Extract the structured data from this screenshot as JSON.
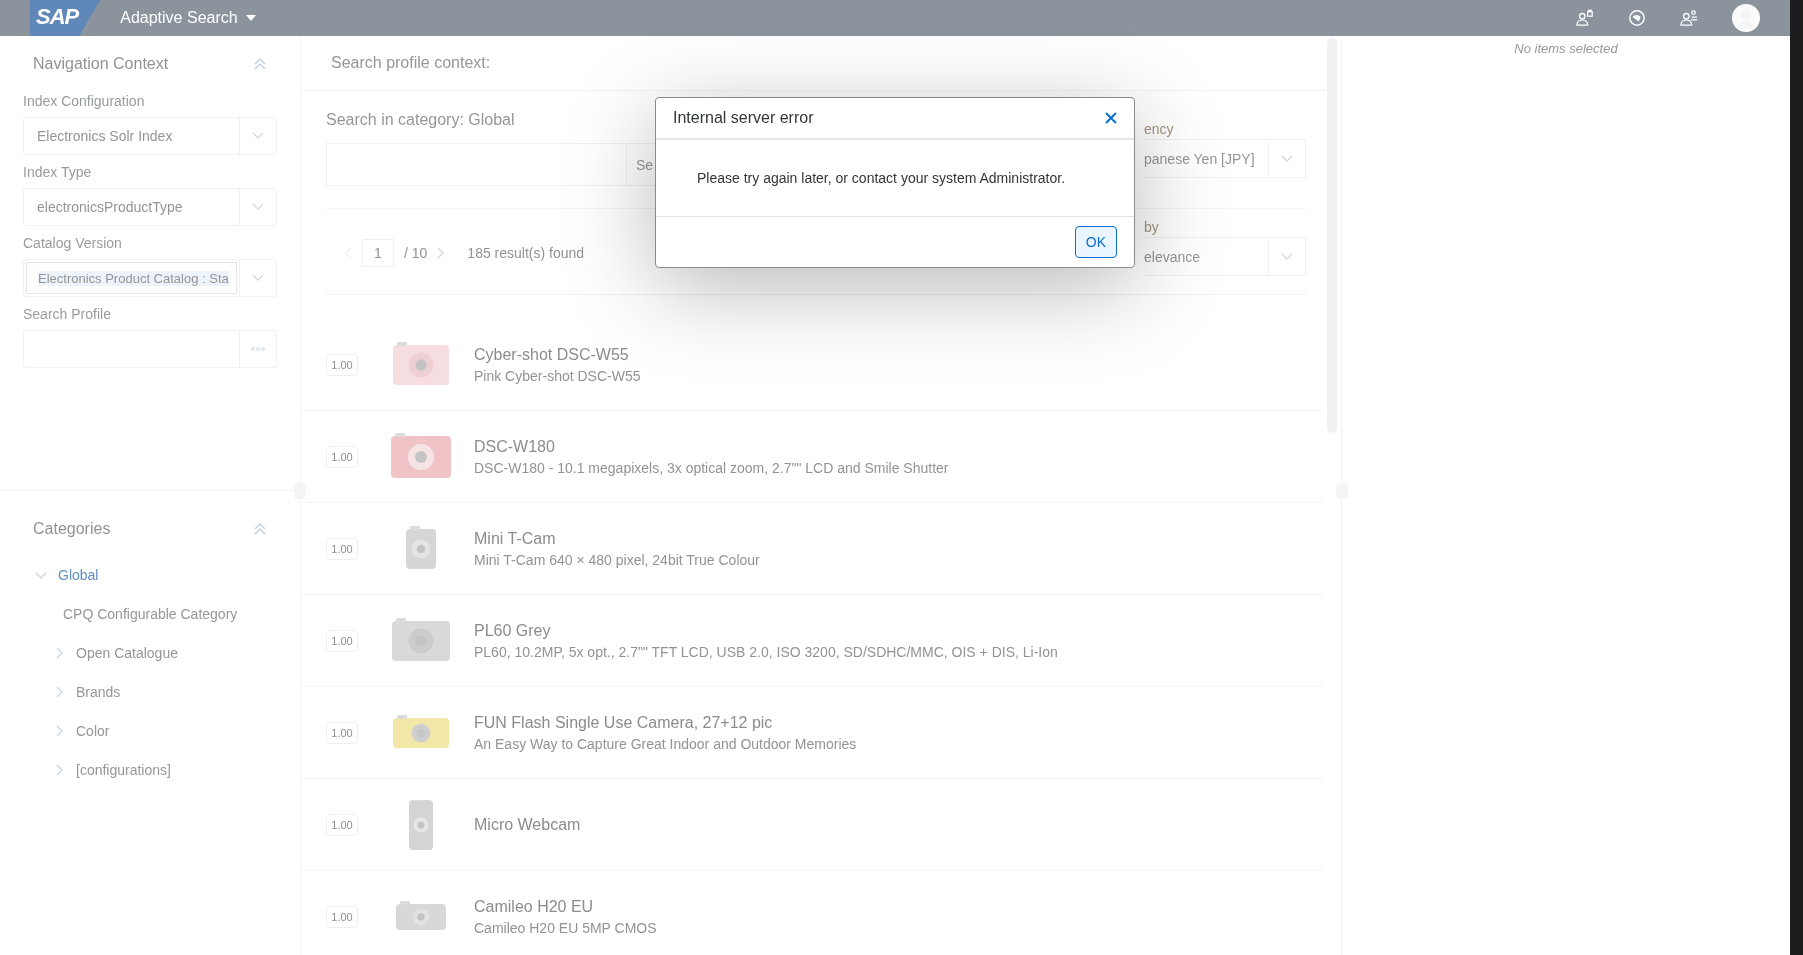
{
  "header": {
    "logo_text": "SAP",
    "app_title": "Adaptive Search"
  },
  "navigation_context": {
    "title": "Navigation Context",
    "fields": [
      {
        "label": "Index Configuration",
        "value": "Electronics Solr Index",
        "kind": "dropdown",
        "highlighted": false
      },
      {
        "label": "Index Type",
        "value": "electronicsProductType",
        "kind": "dropdown",
        "highlighted": false
      },
      {
        "label": "Catalog Version",
        "value": "Electronics Product Catalog : Sta",
        "kind": "dropdown",
        "highlighted": true
      },
      {
        "label": "Search Profile",
        "kind": "value_help",
        "highlighted": false
      }
    ]
  },
  "categories": {
    "title": "Categories",
    "tree": [
      {
        "label": "Global",
        "expandable": true,
        "expanded": true,
        "selected": true,
        "children": [
          {
            "label": "CPQ Configurable Category",
            "expandable": false,
            "expanded": false,
            "selected": false
          },
          {
            "label": "Open Catalogue",
            "expandable": true,
            "expanded": false,
            "selected": false
          },
          {
            "label": "Brands",
            "expandable": true,
            "expanded": false,
            "selected": false
          },
          {
            "label": "Color",
            "expandable": true,
            "expanded": false,
            "selected": false
          },
          {
            "label": "[configurations]",
            "expandable": true,
            "expanded": false,
            "selected": false
          }
        ]
      }
    ]
  },
  "search": {
    "context_title": "Search profile context:",
    "category_label": "Search in category: Global",
    "button": "Se",
    "currency_label": "ency",
    "currency_value": "panese Yen [JPY]",
    "sort_label": "by",
    "sort_value": "elevance"
  },
  "pagination": {
    "page": "1",
    "total": "/ 10",
    "prev_disabled": true,
    "next_disabled": false,
    "results": "185 result(s) found"
  },
  "products": [
    {
      "score": "1.00",
      "name": "Cyber-shot DSC-W55",
      "description": "Pink Cyber-shot DSC-W55"
    },
    {
      "score": "1.00",
      "name": "DSC-W180",
      "description": "DSC-W180 - 10.1 megapixels, 3x optical zoom, 2.7\"\" LCD and Smile Shutter"
    },
    {
      "score": "1.00",
      "name": "Mini T-Cam",
      "description": "Mini T-Cam 640 × 480 pixel, 24bit True Colour"
    },
    {
      "score": "1.00",
      "name": "PL60 Grey",
      "description": "PL60, 10.2MP, 5x opt., 2.7\"\" TFT LCD, USB 2.0, ISO 3200, SD/SDHC/MMC, OIS + DIS, Li-Ion"
    },
    {
      "score": "1.00",
      "name": "FUN Flash Single Use Camera, 27+12 pic",
      "description": "An Easy Way to Capture Great Indoor and Outdoor Memories"
    },
    {
      "score": "1.00",
      "name": "Micro Webcam"
    },
    {
      "score": "1.00",
      "name": "Camileo H20 EU",
      "description": "Camileo H20 EU 5MP CMOS"
    }
  ],
  "selection_panel": {
    "empty_text": "No items selected"
  },
  "dialog": {
    "title": "Internal server error",
    "message": "Please try again later, or contact your system Administrator.",
    "button": "OK"
  }
}
